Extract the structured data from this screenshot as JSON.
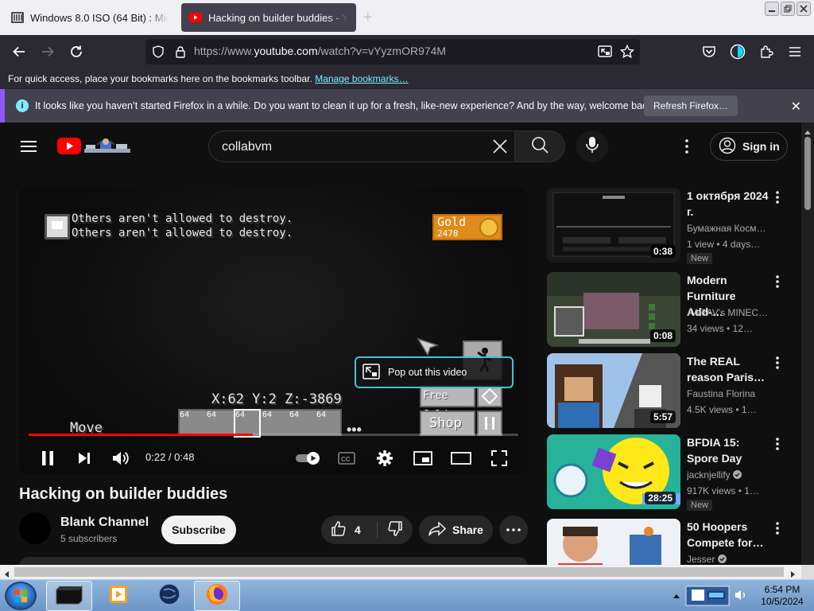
{
  "browser": {
    "tabs": [
      {
        "title": "Windows 8.0 ISO (64 Bit) : Micro",
        "icon": "archive-icon",
        "active": false
      },
      {
        "title": "Hacking on builder buddies - Yo",
        "icon": "youtube-icon",
        "active": true
      }
    ],
    "url_prefix": "https://www.",
    "url_domain": "youtube.com",
    "url_path": "/watch?v=vYyzmOR974M",
    "bookmarks_text": "For quick access, place your bookmarks here on the bookmarks toolbar.",
    "bookmarks_link": "Manage bookmarks…",
    "notice_text": "It looks like you haven’t started Firefox in a while. Do you want to clean it up for a fresh, like-new experience? And by the way, welcome back!",
    "notice_button": "Refresh Firefox…"
  },
  "youtube": {
    "search_query": "collabvm",
    "signin_label": "Sign in",
    "player": {
      "chat_lines": [
        "Others aren't allowed to destroy.",
        "Others aren't allowed to destroy."
      ],
      "gold_label": "Gold",
      "gold_value": "2478",
      "coords": "X:62 Y:2 Z:-3869",
      "move_label": "Move",
      "hotbar_slots": [
        "64",
        "64",
        "64",
        "64",
        "64",
        "64"
      ],
      "free_gold_label": "Free Gold",
      "shop_label": "Shop",
      "popout_label": "Pop out this video",
      "time_current": "0:22",
      "time_separator": " / ",
      "time_total": "0:48",
      "progress_fraction": 0.458
    },
    "video": {
      "title": "Hacking on builder buddies",
      "channel_name": "Blank Channel",
      "subscribers": "5 subscribers",
      "subscribe_label": "Subscribe",
      "likes": "4",
      "share_label": "Share"
    },
    "recommendations": [
      {
        "title": "1 октября 2024 г.",
        "channel": "Бумажная Косм…",
        "meta": "1 view • 4 days…",
        "duration": "0:38",
        "badge": "New"
      },
      {
        "title": "Modern Furniture Add-…",
        "channel": "AARAV's MINEC…",
        "meta": "34 views • 12…",
        "duration": "0:08",
        "badge": ""
      },
      {
        "title": "The REAL reason Paris…",
        "channel": "Faustina Florina",
        "meta": "4.5K views • 1…",
        "duration": "5:57",
        "badge": ""
      },
      {
        "title": "BFDIA 15: Spore Day",
        "channel": "jacknjellify",
        "meta": "917K views • 1…",
        "duration": "28:25",
        "badge": "New"
      },
      {
        "title": "50 Hoopers Compete for…",
        "channel": "Jesser",
        "meta": "",
        "duration": "",
        "badge": ""
      }
    ]
  },
  "taskbar": {
    "time": "6:54 PM",
    "date": "10/5/2024"
  },
  "colors": {
    "youtube_red": "#ff0000",
    "popout_border": "#3fc3d5",
    "firefox_link": "#80ebff",
    "notice_accent": "#9059ff"
  }
}
